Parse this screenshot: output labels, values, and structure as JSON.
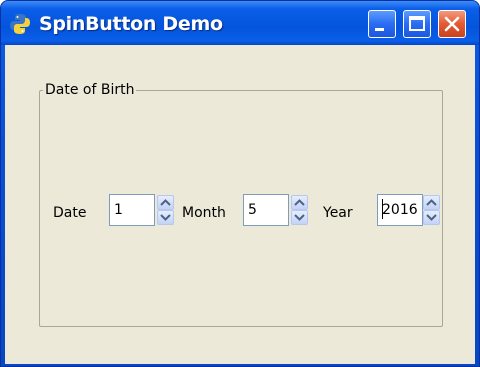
{
  "window": {
    "title": "SpinButton Demo",
    "icon": "python-icon",
    "controls": {
      "minimize": "minimize-icon",
      "maximize": "maximize-icon",
      "close": "close-icon"
    },
    "colors": {
      "titlebar": "#0a5ee8",
      "client": "#ece9d8",
      "close_button": "#e35a33"
    }
  },
  "group": {
    "title": "Date of Birth"
  },
  "fields": {
    "date": {
      "label": "Date",
      "value": "1"
    },
    "month": {
      "label": "Month",
      "value": "5"
    },
    "year": {
      "label": "Year",
      "value": "2016"
    }
  }
}
